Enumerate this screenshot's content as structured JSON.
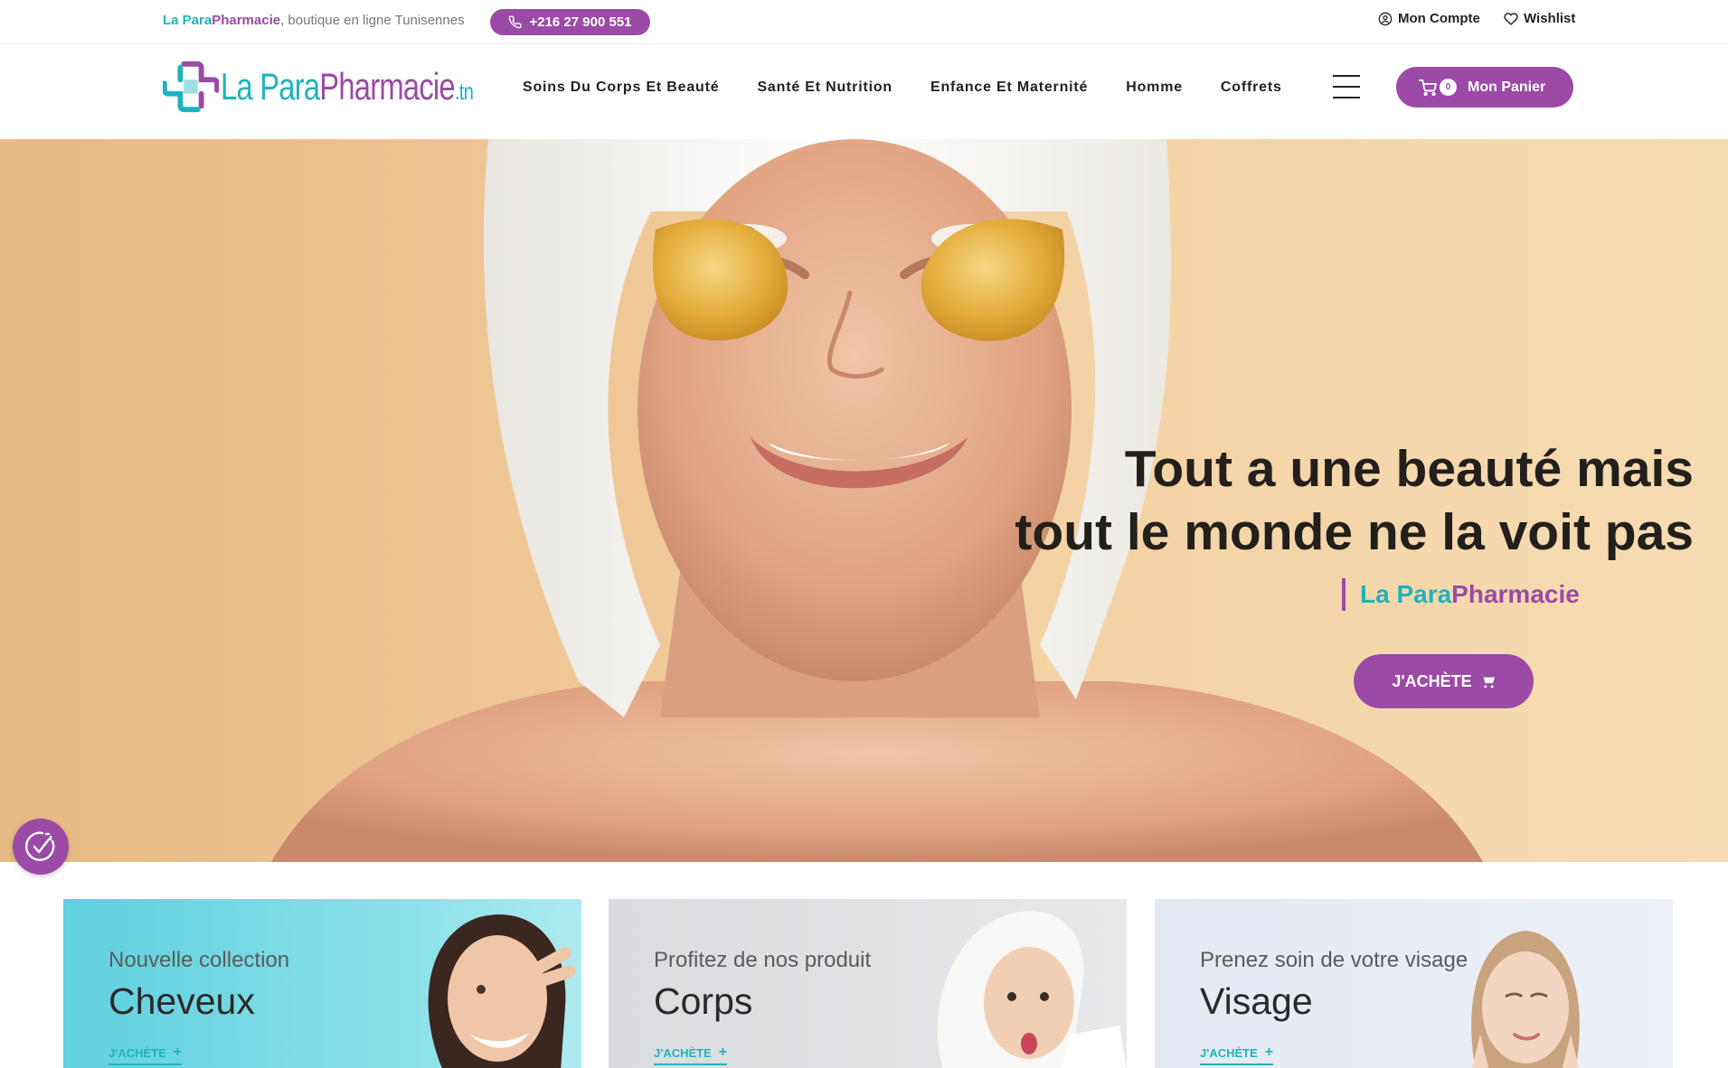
{
  "colors": {
    "brand_purple": "#9b4aa6",
    "brand_teal": "#1fb3be"
  },
  "topbar": {
    "tagline_part1": "La Para",
    "tagline_part2": "Pharmacie",
    "tagline_rest": ", boutique en ligne Tunisennes",
    "phone": "+216 27 900 551",
    "account_label": "Mon Compte",
    "wishlist_label": "Wishlist"
  },
  "logo": {
    "part1": "La Para",
    "part2": "Pharmacie",
    "part3": ".tn"
  },
  "nav": {
    "items": [
      {
        "label": "Soins Du Corps Et Beauté"
      },
      {
        "label": "Santé Et Nutrition"
      },
      {
        "label": "Enfance Et Maternité"
      },
      {
        "label": "Homme"
      },
      {
        "label": "Coffrets"
      }
    ],
    "cart_count": "0",
    "cart_label": "Mon Panier"
  },
  "hero": {
    "title_line1": "Tout a une beauté mais",
    "title_line2": "tout le monde ne la voit pas",
    "brand_part1": "La Para",
    "brand_part2": "Pharmacie",
    "cta": "J'ACHÈTE"
  },
  "cards": [
    {
      "kicker": "Nouvelle collection",
      "title": "Cheveux",
      "link": "J'ACHÈTE",
      "plus": "+"
    },
    {
      "kicker": "Profitez de nos produit",
      "title": "Corps",
      "link": "J'ACHÈTE",
      "plus": "+"
    },
    {
      "kicker": "Prenez soin de votre visage",
      "title": "Visage",
      "link": "J'ACHÈTE",
      "plus": "+"
    }
  ]
}
